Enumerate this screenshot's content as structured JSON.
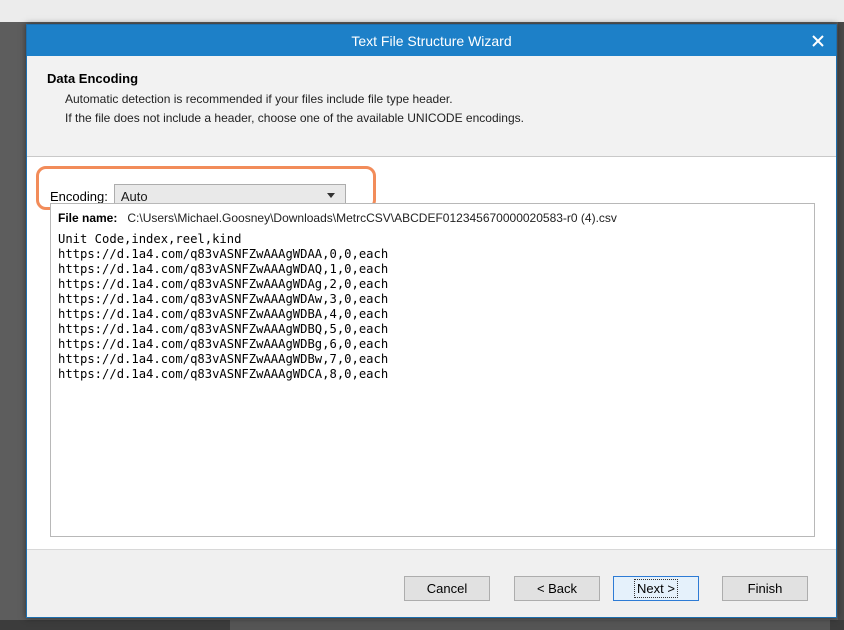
{
  "window": {
    "title": "Text File Structure Wizard"
  },
  "header": {
    "title": "Data Encoding",
    "line1": "Automatic detection is recommended if your files include file type header.",
    "line2": "If the file does not include a header, choose one of the available UNICODE encodings."
  },
  "encoding": {
    "label": "Encoding:",
    "value": "Auto"
  },
  "preview": {
    "file_label": "File name:",
    "file_path": "C:\\Users\\Michael.Goosney\\Downloads\\MetrcCSV\\ABCDEF012345670000020583-r0 (4).csv",
    "lines": [
      "Unit Code,index,reel,kind",
      "https://d.1a4.com/q83vASNFZwAAAgWDAA,0,0,each",
      "https://d.1a4.com/q83vASNFZwAAAgWDAQ,1,0,each",
      "https://d.1a4.com/q83vASNFZwAAAgWDAg,2,0,each",
      "https://d.1a4.com/q83vASNFZwAAAgWDAw,3,0,each",
      "https://d.1a4.com/q83vASNFZwAAAgWDBA,4,0,each",
      "https://d.1a4.com/q83vASNFZwAAAgWDBQ,5,0,each",
      "https://d.1a4.com/q83vASNFZwAAAgWDBg,6,0,each",
      "https://d.1a4.com/q83vASNFZwAAAgWDBw,7,0,each",
      "https://d.1a4.com/q83vASNFZwAAAgWDCA,8,0,each"
    ]
  },
  "buttons": {
    "cancel": "Cancel",
    "back": "< Back",
    "next": "Next >",
    "finish": "Finish"
  },
  "icons": {
    "close": "close-icon",
    "dropdown": "chevron-down-icon"
  },
  "colors": {
    "titlebar": "#1d80c8",
    "highlight": "#f28c5a"
  }
}
